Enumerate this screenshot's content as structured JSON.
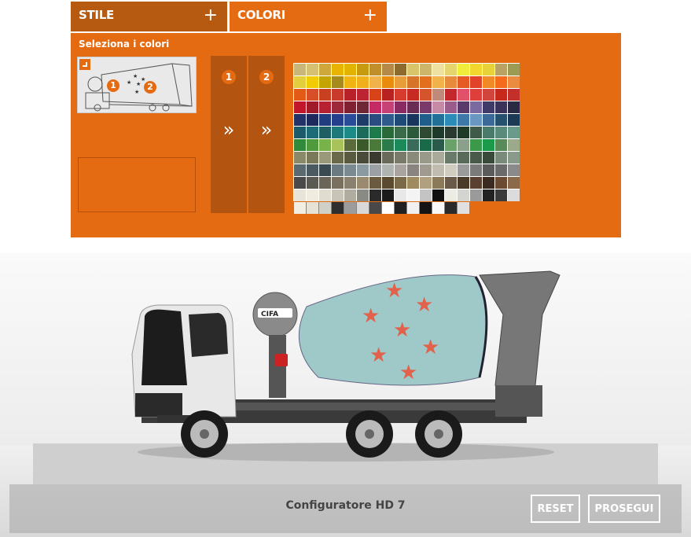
{
  "tabs": [
    {
      "label": "STILE",
      "plus": "+"
    },
    {
      "label": "COLORI",
      "plus": "+"
    }
  ],
  "panel": {
    "title": "Seleziona i colori",
    "thumbnail_badges": [
      "1",
      "2"
    ],
    "slots": [
      {
        "number": "1",
        "arrow": "»"
      },
      {
        "number": "2",
        "arrow": "»"
      }
    ]
  },
  "palette": {
    "colors": [
      "#c8b778",
      "#d6c173",
      "#cfa83b",
      "#e8b400",
      "#e2b300",
      "#c79a10",
      "#c18e2c",
      "#b58a48",
      "#8d6a2e",
      "#d8c56b",
      "#cdb56c",
      "#efe1a1",
      "#e6d56e",
      "#f0ee3b",
      "#f2d72e",
      "#e7d23a",
      "#b8a264",
      "#9b9b53",
      "#e3cf3e",
      "#f1cc06",
      "#c3a400",
      "#a78a1e",
      "#efb412",
      "#efb01b",
      "#f2b24a",
      "#e98b0c",
      "#e79e3a",
      "#d6752a",
      "#e26f1d",
      "#f1b24b",
      "#e88a3c",
      "#e65a26",
      "#e0432a",
      "#f18a26",
      "#f46b1b",
      "#ea8b3f",
      "#e35a17",
      "#d84e27",
      "#c8401f",
      "#c93a2c",
      "#b8212a",
      "#bd2432",
      "#d9431a",
      "#b8211f",
      "#d63c2e",
      "#c72a23",
      "#d5542b",
      "#c08a7a",
      "#c3282c",
      "#e1516a",
      "#de3f3a",
      "#d1453d",
      "#c6281b",
      "#c32f2a",
      "#c2162a",
      "#a11a29",
      "#b72232",
      "#9c2a3a",
      "#7f2130",
      "#6e2734",
      "#c42b64",
      "#c64276",
      "#8a2a63",
      "#6a2c53",
      "#7a3a6a",
      "#c78aa6",
      "#9a5c8a",
      "#5a3a6a",
      "#7a6aa0",
      "#403a68",
      "#3a3258",
      "#2a2a44",
      "#23336a",
      "#1e2a5e",
      "#223c80",
      "#253f8d",
      "#2a4b98",
      "#1f3c68",
      "#2b4c7f",
      "#30598c",
      "#1f4a78",
      "#17355d",
      "#1f5d8a",
      "#207098",
      "#2d8bb8",
      "#3e78a8",
      "#6a96c2",
      "#3b6a98",
      "#25506e",
      "#1c3a55",
      "#1b5a6b",
      "#1d6b76",
      "#1f5e62",
      "#1e7a7a",
      "#1c8a86",
      "#1c6a5a",
      "#1e7a4a",
      "#2a6a3a",
      "#3a6a4a",
      "#2a5a3a",
      "#2e4a32",
      "#1f3a2a",
      "#2a3a30",
      "#203a2a",
      "#405a4a",
      "#4a7a6a",
      "#5a8a7a",
      "#6a9a8a",
      "#2f8a3a",
      "#4f9a3a",
      "#7ab24a",
      "#a9c25a",
      "#5a6a3a",
      "#3a5a2a",
      "#4a7a3a",
      "#2a7a4a",
      "#1a8a5a",
      "#3a6a5a",
      "#1a6a4a",
      "#2a5a4a",
      "#6aa06a",
      "#8aa08a",
      "#3a9a4a",
      "#1a9a4a",
      "#5a8a5a",
      "#9aaa8a",
      "#8a8a6a",
      "#7a7a5a",
      "#9a9a7a",
      "#6a6a4a",
      "#5a5a40",
      "#4a4a3a",
      "#3a3a30",
      "#6a6a5a",
      "#7a7a6a",
      "#8a8a7a",
      "#9a9a8a",
      "#aaaa9a",
      "#6a7a6a",
      "#5a6a5a",
      "#4a5a4a",
      "#3a4a3a",
      "#7a8a7a",
      "#8a9a8a",
      "#5a6a70",
      "#4a5a60",
      "#3a4a50",
      "#6a7a80",
      "#7a8a90",
      "#8a9aa0",
      "#9aa0a4",
      "#b0b4b0",
      "#aaa4a0",
      "#8a8480",
      "#a09a90",
      "#c0bcb0",
      "#d0ccc0",
      "#9a9a9a",
      "#7a7a7a",
      "#5a5a5a",
      "#6a6a6a",
      "#8a8a8a",
      "#4a4a4a",
      "#5a5a52",
      "#6a6558",
      "#7a7060",
      "#8a8070",
      "#9a8a70",
      "#6a5a40",
      "#5a4a30",
      "#7a6a4a",
      "#a08a60",
      "#b0a080",
      "#8a7a5a",
      "#6a5a4a",
      "#4a3a2a",
      "#5a4030",
      "#3a2a20",
      "#6a4a30",
      "#8a6a4a",
      "#e8e4d8",
      "#f0ece0",
      "#e0dcd0",
      "#c8c4b8",
      "#b0aca0",
      "#8a8a84",
      "#2a2a2a",
      "#1a1a1a",
      "#e8e8e8",
      "#f4f4f4",
      "#c4c4c4",
      "#101010",
      "#ecebe4",
      "#d4d4d0",
      "#9a9a9a",
      "#222222",
      "#3a3a3a",
      "#dcdcdc",
      "#f2efe2",
      "#e6e3d6",
      "#d0cfc8",
      "#2e2e2e",
      "#9c9c9c",
      "#d8d8d8",
      "#484848",
      "#ffffff",
      "#202020",
      "#f0f0f0",
      "#141414",
      "#f8f8f8",
      "#2a2a2a",
      "#e0e0e0"
    ]
  },
  "truck": {
    "logo": "CIFA"
  },
  "footer": {
    "title": "Configuratore HD 7",
    "reset_label": "RESET",
    "next_label": "PROSEGUI"
  }
}
